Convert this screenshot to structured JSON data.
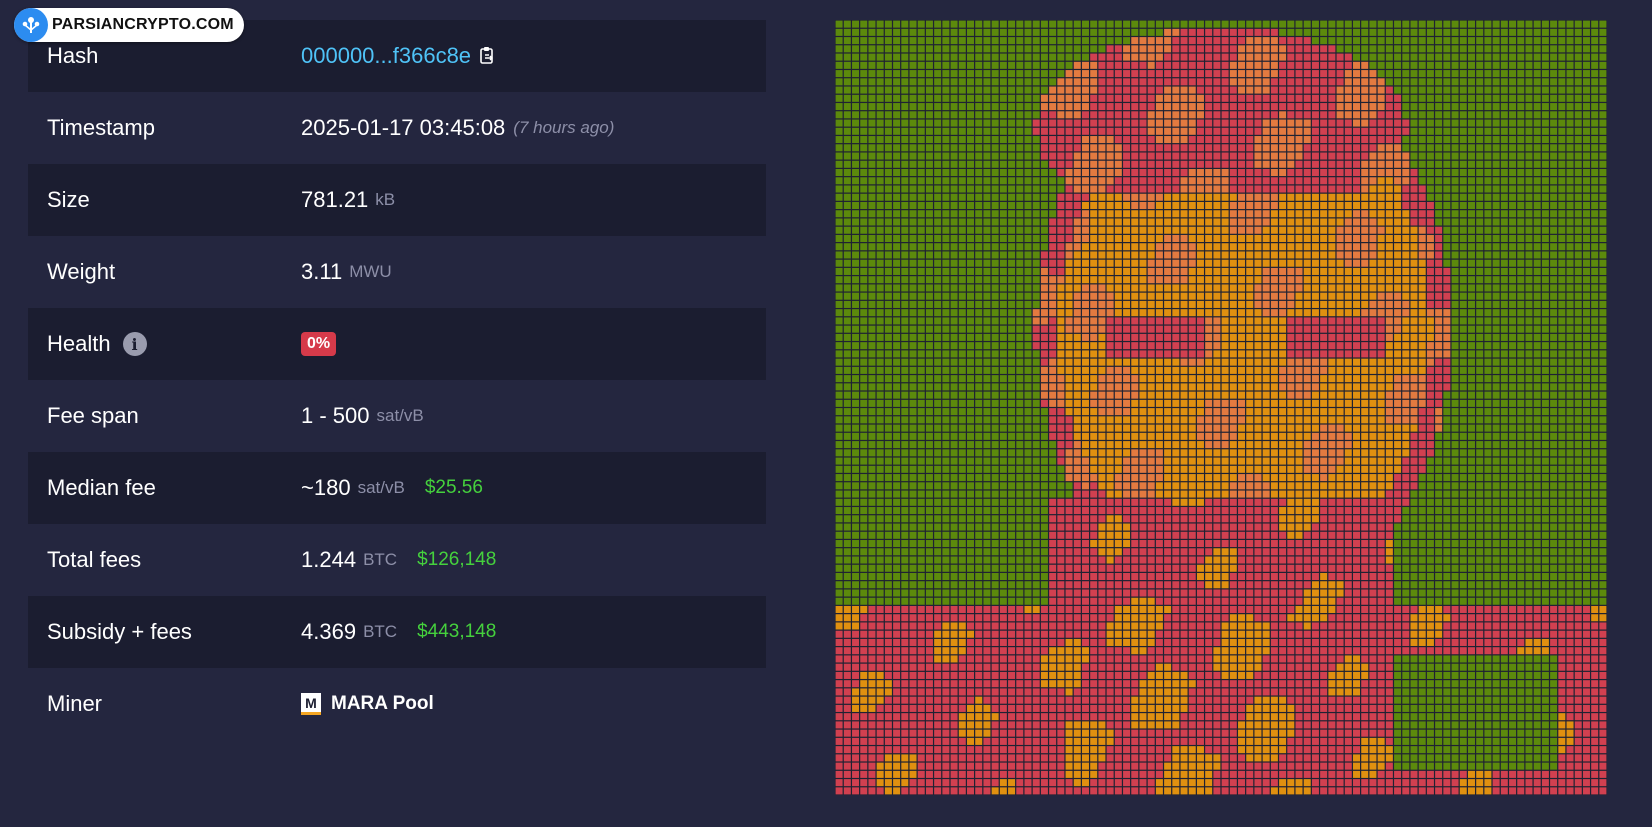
{
  "watermark": {
    "text": "PARSIANCRYPTO.COM",
    "icon": "tree-logo-icon"
  },
  "rows": [
    {
      "label": "Hash",
      "value": "000000...f366c8e",
      "icon": "copy-icon"
    },
    {
      "label": "Timestamp",
      "value": "2025-01-17 03:45:08",
      "note": "(7 hours ago)"
    },
    {
      "label": "Size",
      "value": "781.21",
      "unit": "kB"
    },
    {
      "label": "Weight",
      "value": "3.11",
      "unit": "MWU"
    },
    {
      "label": "Health",
      "value": "0%",
      "icon": "info-icon"
    },
    {
      "label": "Fee span",
      "value": "1 - 500",
      "unit": "sat/vB"
    },
    {
      "label": "Median fee",
      "value": "~180",
      "unit": "sat/vB",
      "fiat": "$25.56"
    },
    {
      "label": "Total fees",
      "value": "1.244",
      "unit": "BTC",
      "fiat": "$126,148"
    },
    {
      "label": "Subsidy + fees",
      "value": "4.369",
      "unit": "BTC",
      "fiat": "$443,148"
    },
    {
      "label": "Miner",
      "value": "MARA Pool",
      "logo_letter": "M"
    }
  ],
  "colors": {
    "background": "#24263f",
    "row_alt": "#1b1d30",
    "hash_link": "#4fc3f7",
    "fiat_green": "#45d13d",
    "health_badge": "#d63a4a",
    "mosaic_green": "#5c8a0c",
    "mosaic_orange": "#e09010",
    "mosaic_red": "#d14050",
    "mosaic_salmon": "#e37a40"
  }
}
